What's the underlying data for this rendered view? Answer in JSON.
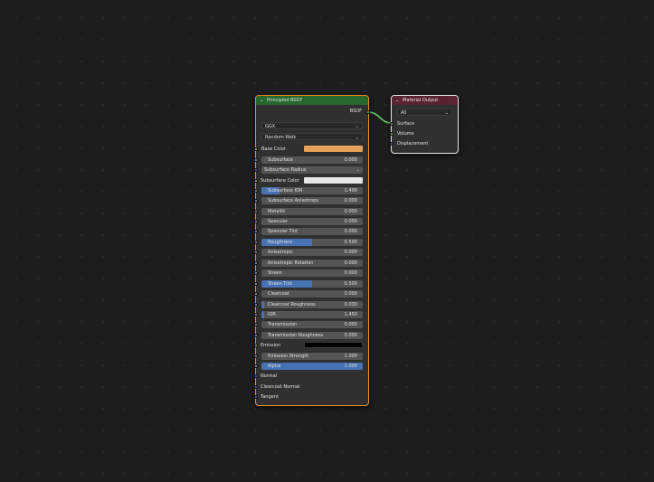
{
  "bsdf_node": {
    "title": "Principled BSDF",
    "output_socket": "BSDF",
    "distribution": "GGX",
    "subsurface_method": "Random Walk",
    "base_color": {
      "label": "Base Color",
      "color": "#e8a15a"
    },
    "subsurface_color": {
      "label": "Subsurface Color",
      "color": "#e6e6e6"
    },
    "emission": {
      "label": "Emission",
      "color": "#000000"
    },
    "subsurface_radius": "Subsurface Radius",
    "fields": {
      "subsurface": {
        "label": "Subsurface",
        "value": "0.000",
        "fill": 0
      },
      "subsurface_ior": {
        "label": "Subsurface IOR",
        "value": "1.400",
        "fill": 0.45
      },
      "subsurface_anisotropy": {
        "label": "Subsurface Anisotropy",
        "value": "0.000",
        "fill": 0
      },
      "metallic": {
        "label": "Metallic",
        "value": "0.000",
        "fill": 0
      },
      "specular": {
        "label": "Specular",
        "value": "0.000",
        "fill": 0
      },
      "specular_tint": {
        "label": "Specular Tint",
        "value": "0.000",
        "fill": 0
      },
      "roughness": {
        "label": "Roughness",
        "value": "0.500",
        "fill": 0.5
      },
      "anisotropic": {
        "label": "Anisotropic",
        "value": "0.000",
        "fill": 0
      },
      "anisotropic_rotation": {
        "label": "Anisotropic Rotation",
        "value": "0.000",
        "fill": 0
      },
      "sheen": {
        "label": "Sheen",
        "value": "0.000",
        "fill": 0
      },
      "sheen_tint": {
        "label": "Sheen Tint",
        "value": "0.500",
        "fill": 0.5
      },
      "clearcoat": {
        "label": "Clearcoat",
        "value": "0.000",
        "fill": 0
      },
      "clearcoat_roughness": {
        "label": "Clearcoat Roughness",
        "value": "0.030",
        "fill": 0
      },
      "ior": {
        "label": "IOR",
        "value": "1.450",
        "fill": 0
      },
      "transmission": {
        "label": "Transmission",
        "value": "0.000",
        "fill": 0
      },
      "transmission_roughness": {
        "label": "Transmission Roughness",
        "value": "0.000",
        "fill": 0
      },
      "emission_strength": {
        "label": "Emission Strength",
        "value": "1.000",
        "fill": 0
      },
      "alpha": {
        "label": "Alpha",
        "value": "1.000",
        "fill": 1
      }
    },
    "normal": "Normal",
    "clearcoat_normal": "Clearcoat Normal",
    "tangent": "Tangent"
  },
  "output_node": {
    "title": "Material Output",
    "target": "All",
    "sockets": [
      "Surface",
      "Volume",
      "Displacement"
    ]
  },
  "colors": {
    "bsdf_header": "#27682e",
    "output_header": "#5a2331",
    "slider_fill": "#4772b3",
    "selected_border": "#e88a1a"
  }
}
